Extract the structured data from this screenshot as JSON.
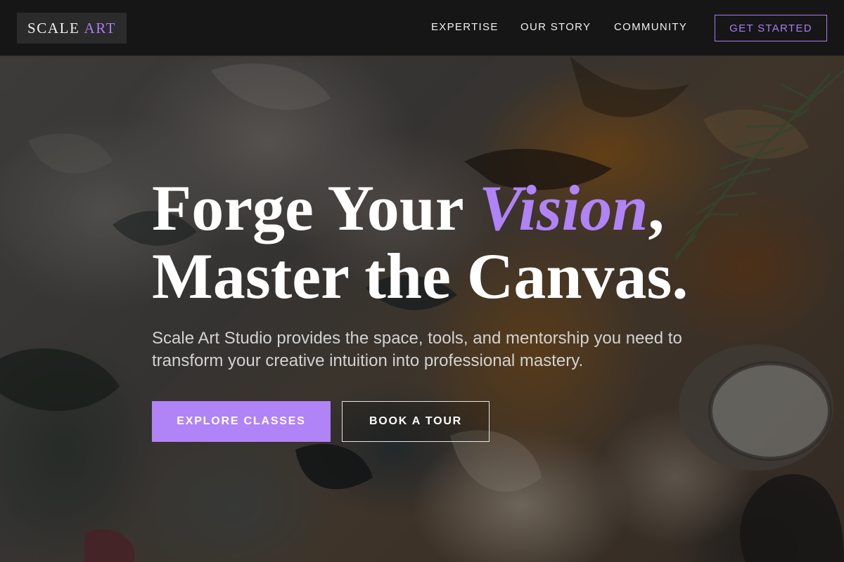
{
  "brand": {
    "name": "SCALE",
    "accent": "ART",
    "accent_color": "#a97cf2"
  },
  "nav": {
    "items": [
      {
        "label": "EXPERTISE"
      },
      {
        "label": "OUR STORY"
      },
      {
        "label": "COMMUNITY"
      }
    ],
    "cta_label": "GET STARTED"
  },
  "hero": {
    "title_line1_prefix": "Forge Your ",
    "title_accent": "Vision",
    "title_line1_suffix": ",",
    "title_line2": "Master the Canvas.",
    "subtitle": "Scale Art Studio provides the space, tools, and mentorship you need to transform your creative intuition into professional mastery.",
    "primary_button": "EXPLORE CLASSES",
    "secondary_button": "BOOK A TOUR"
  },
  "colors": {
    "header_bg": "#161616",
    "accent": "#b083f7",
    "text": "#ffffff"
  }
}
